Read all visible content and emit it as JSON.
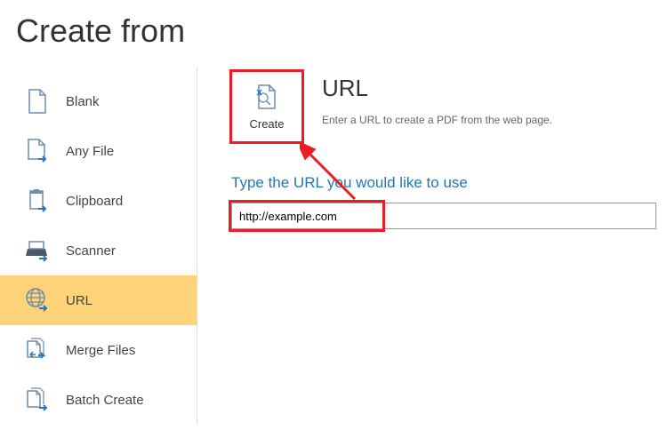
{
  "page": {
    "title": "Create from"
  },
  "sidebar": {
    "items": [
      {
        "label": "Blank"
      },
      {
        "label": "Any File"
      },
      {
        "label": "Clipboard"
      },
      {
        "label": "Scanner"
      },
      {
        "label": "URL"
      },
      {
        "label": "Merge Files"
      },
      {
        "label": "Batch Create"
      }
    ]
  },
  "main": {
    "create_label": "Create",
    "title": "URL",
    "description": "Enter a URL to create a PDF from the web page.",
    "prompt": "Type the URL you would like to use",
    "url_value": "http://example.com"
  }
}
